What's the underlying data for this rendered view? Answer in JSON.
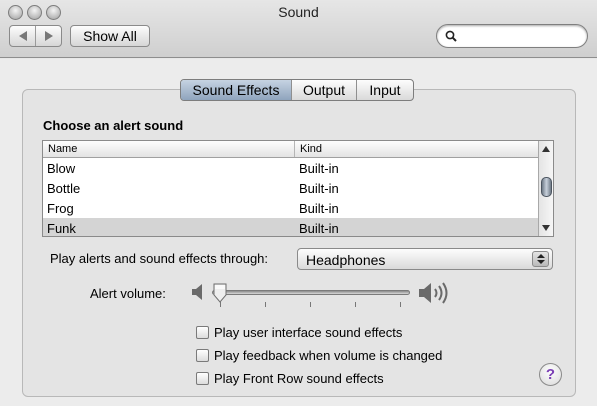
{
  "window": {
    "title": "Sound",
    "traffic_lights": [
      "close",
      "minimize",
      "zoom"
    ]
  },
  "toolbar": {
    "back_icon": "arrow-left-icon",
    "forward_icon": "arrow-right-icon",
    "show_all_label": "Show All",
    "search": {
      "value": "",
      "placeholder": "",
      "icon": "search-icon"
    }
  },
  "tabs": [
    {
      "label": "Sound Effects",
      "selected": true
    },
    {
      "label": "Output",
      "selected": false
    },
    {
      "label": "Input",
      "selected": false
    }
  ],
  "sound_effects": {
    "heading": "Choose an alert sound",
    "columns": [
      "Name",
      "Kind"
    ],
    "rows": [
      {
        "name": "Blow",
        "kind": "Built-in",
        "selected": false
      },
      {
        "name": "Bottle",
        "kind": "Built-in",
        "selected": false
      },
      {
        "name": "Frog",
        "kind": "Built-in",
        "selected": false
      },
      {
        "name": "Funk",
        "kind": "Built-in",
        "selected": true
      }
    ],
    "play_through_label": "Play alerts and sound effects through:",
    "play_through_value": "Headphones",
    "alert_volume_label": "Alert volume:",
    "alert_volume_level": 0.0,
    "checkboxes": [
      {
        "label": "Play user interface sound effects",
        "checked": false
      },
      {
        "label": "Play feedback when volume is changed",
        "checked": false
      },
      {
        "label": "Play Front Row sound effects",
        "checked": false
      }
    ],
    "help_label": "?"
  },
  "colors": {
    "selected_tab": "#9fb2c8",
    "selected_row": "#d4d4d4",
    "help_accent": "#7b3fb5"
  }
}
